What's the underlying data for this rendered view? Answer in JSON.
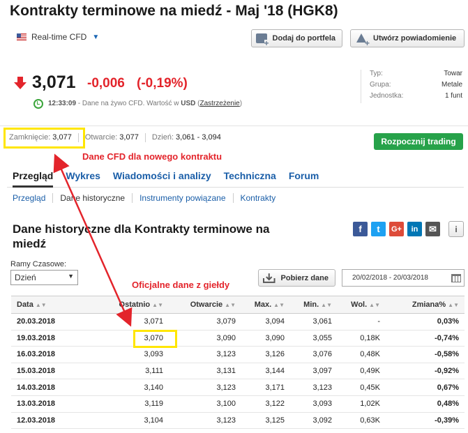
{
  "header": {
    "title": "Kontrakty terminowe na miedź - Maj '18 (HGK8)",
    "realtime_label": "Real-time CFD",
    "add_portfolio": "Dodaj do portfela",
    "create_alert": "Utwórz powiadomienie"
  },
  "quote": {
    "price": "3,071",
    "change": "-0,006",
    "change_pct": "(-0,19%)",
    "time": "12:33:09",
    "note": "- Dane na żywo CFD. Wartość w",
    "currency": "USD",
    "disclaimer": "Zastrzeżenie",
    "up_color": "#2a9d2a",
    "down_color": "#e3242b"
  },
  "info": [
    {
      "label": "Typ:",
      "value": "Towar"
    },
    {
      "label": "Grupa:",
      "value": "Metale"
    },
    {
      "label": "Jednostka:",
      "value": "1 funt"
    }
  ],
  "stats": {
    "close_label": "Zamknięcie:",
    "close_value": "3,077",
    "open_label": "Otwarcie:",
    "open_value": "3,077",
    "day_label": "Dzień:",
    "day_value": "3,061 - 3,094"
  },
  "start_trading": "Rozpocznij trading",
  "annotations": {
    "cfd": "Dane CFD dla nowego kontraktu",
    "official": "Oficjalne dane z giełdy"
  },
  "tabs": [
    "Przegląd",
    "Wykres",
    "Wiadomości i analizy",
    "Techniczna",
    "Forum"
  ],
  "subtabs": [
    "Przegląd",
    "Dane historyczne",
    "Instrumenty powiązane",
    "Kontrakty"
  ],
  "historical": {
    "title": "Dane historyczne dla Kontrakty terminowe na miedź",
    "timeframe_label": "Ramy Czasowe:",
    "timeframe_value": "Dzień",
    "download": "Pobierz dane",
    "date_range": "20/02/2018 - 20/03/2018",
    "columns": [
      "Data",
      "Ostatnio",
      "Otwarcie",
      "Max.",
      "Min.",
      "Wol.",
      "Zmiana%"
    ],
    "rows": [
      {
        "date": "20.03.2018",
        "last": "3,071",
        "open": "3,079",
        "max": "3,094",
        "min": "3,061",
        "vol": "-",
        "chg": "0,03%",
        "dir": "up"
      },
      {
        "date": "19.03.2018",
        "last": "3,070",
        "open": "3,090",
        "max": "3,090",
        "min": "3,055",
        "vol": "0,18K",
        "chg": "-0,74%",
        "dir": "dn"
      },
      {
        "date": "16.03.2018",
        "last": "3,093",
        "open": "3,123",
        "max": "3,126",
        "min": "3,076",
        "vol": "0,48K",
        "chg": "-0,58%",
        "dir": "dn"
      },
      {
        "date": "15.03.2018",
        "last": "3,111",
        "open": "3,131",
        "max": "3,144",
        "min": "3,097",
        "vol": "0,49K",
        "chg": "-0,92%",
        "dir": "dn"
      },
      {
        "date": "14.03.2018",
        "last": "3,140",
        "open": "3,123",
        "max": "3,171",
        "min": "3,123",
        "vol": "0,45K",
        "chg": "0,67%",
        "dir": "up"
      },
      {
        "date": "13.03.2018",
        "last": "3,119",
        "open": "3,100",
        "max": "3,122",
        "min": "3,093",
        "vol": "1,02K",
        "chg": "0,48%",
        "dir": "up"
      },
      {
        "date": "12.03.2018",
        "last": "3,104",
        "open": "3,123",
        "max": "3,125",
        "min": "3,092",
        "vol": "0,63K",
        "chg": "-0,39%",
        "dir": "dn"
      }
    ]
  }
}
